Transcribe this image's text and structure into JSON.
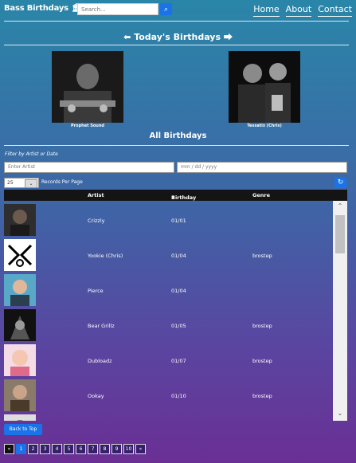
{
  "header": {
    "brand": "Bass Birthdays",
    "brand_icon": "equalizer-icon",
    "search_placeholder": "Search...",
    "search_icon": "search-icon",
    "nav": [
      "Home",
      "About",
      "Contact"
    ]
  },
  "today": {
    "title": "Today's Birthdays",
    "featured": [
      {
        "name": "Prophet Sound"
      },
      {
        "name": "Tessatix (Chris)"
      }
    ]
  },
  "all": {
    "title": "All Birthdays",
    "filter_label": "Filter by Artist or Date",
    "artist_placeholder": "Enter Artist",
    "date_placeholder": "mm / dd / yyyy",
    "records_per_page_value": "25",
    "records_per_page_label": "Records Per Page",
    "refresh_icon": "refresh-icon",
    "columns": {
      "artist": "Artist",
      "birthday": "Birthday",
      "genre": "Genre"
    },
    "sort_indicator": "↑",
    "rows": [
      {
        "artist": "Crizzly",
        "birthday": "01/01",
        "genre": ""
      },
      {
        "artist": "Yookie (Chris)",
        "birthday": "01/04",
        "genre": "brostep"
      },
      {
        "artist": "Pierce",
        "birthday": "01/04",
        "genre": ""
      },
      {
        "artist": "Bear Grillz",
        "birthday": "01/05",
        "genre": "brostep"
      },
      {
        "artist": "Dubloadz",
        "birthday": "01/07",
        "genre": "brostep"
      },
      {
        "artist": "Ookay",
        "birthday": "01/10",
        "genre": "brostep"
      },
      {
        "artist": "",
        "birthday": "",
        "genre": ""
      }
    ],
    "back_to_top": "Back to Top",
    "pager": [
      "«",
      "1",
      "2",
      "3",
      "4",
      "5",
      "6",
      "7",
      "8",
      "9",
      "10",
      "»"
    ],
    "active_page": "1"
  }
}
